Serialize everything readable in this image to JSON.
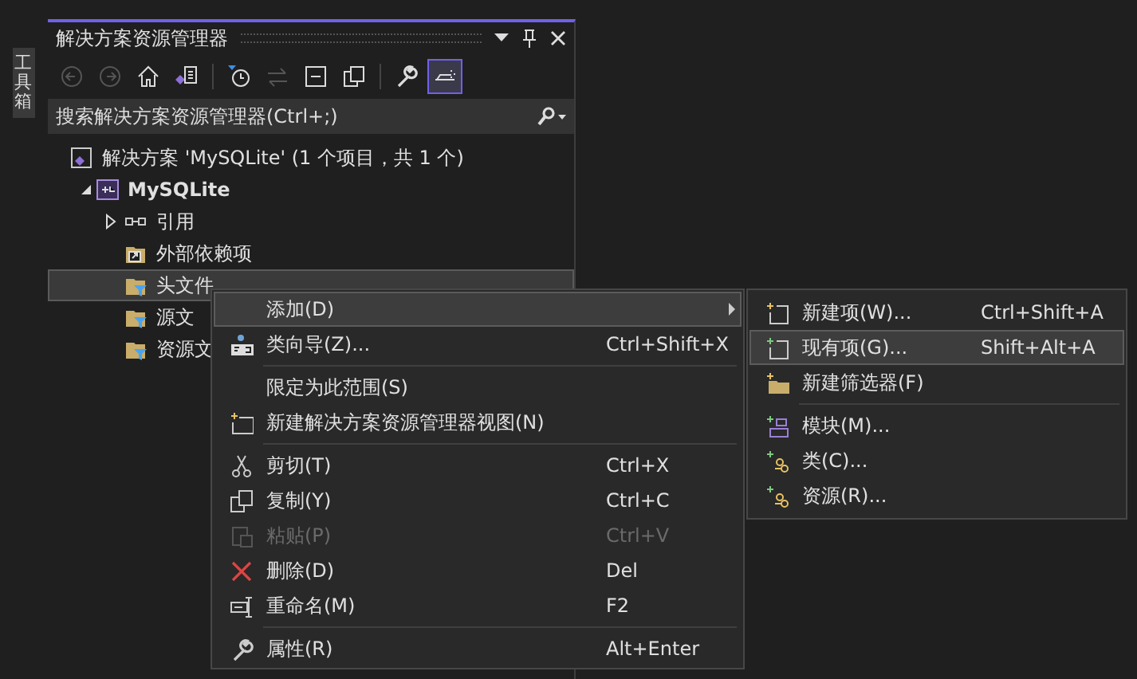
{
  "toolbox": {
    "label": "工具箱"
  },
  "panel": {
    "title": "解决方案资源管理器",
    "toolbar": [
      {
        "kind": "back",
        "disabled": true
      },
      {
        "kind": "forward",
        "disabled": true
      },
      {
        "kind": "home",
        "disabled": false
      },
      {
        "kind": "switch-views",
        "disabled": false
      },
      {
        "kind": "history",
        "disabled": false
      },
      {
        "kind": "sync",
        "disabled": true
      },
      {
        "kind": "collapse",
        "disabled": false
      },
      {
        "kind": "show-all",
        "disabled": false
      },
      {
        "kind": "properties",
        "disabled": false
      },
      {
        "kind": "preview",
        "disabled": false,
        "selected": true
      }
    ],
    "search": {
      "placeholder": "搜索解决方案资源管理器(Ctrl+;)"
    },
    "tree": [
      {
        "kind": "solution",
        "label": "解决方案 'MySQLite' (1 个项目，共 1 个)",
        "selected": false,
        "children": [
          {
            "kind": "project",
            "label": "MySQLite",
            "expanded": true,
            "selected": false,
            "children": [
              {
                "kind": "references",
                "label": "引用",
                "expanded": false,
                "selected": false
              },
              {
                "kind": "external",
                "label": "外部依赖项",
                "selected": false
              },
              {
                "kind": "filter",
                "label": "头文件",
                "selected": true
              },
              {
                "kind": "filter",
                "label": "源文",
                "selected": false
              },
              {
                "kind": "filter",
                "label": "资源文",
                "selected": false
              }
            ]
          }
        ]
      }
    ]
  },
  "context_menu": {
    "items": [
      {
        "kind": "item",
        "label": "添加(D)",
        "submenu": true,
        "selected": true,
        "disabled": false
      },
      {
        "kind": "item",
        "label": "类向导(Z)...",
        "shortcut": "Ctrl+Shift+X",
        "selected": false,
        "disabled": false
      },
      {
        "kind": "separator"
      },
      {
        "kind": "item",
        "label": "限定为此范围(S)",
        "selected": false,
        "disabled": false
      },
      {
        "kind": "item",
        "label": "新建解决方案资源管理器视图(N)",
        "selected": false,
        "disabled": false
      },
      {
        "kind": "separator"
      },
      {
        "kind": "item",
        "label": "剪切(T)",
        "shortcut": "Ctrl+X",
        "selected": false,
        "disabled": false
      },
      {
        "kind": "item",
        "label": "复制(Y)",
        "shortcut": "Ctrl+C",
        "selected": false,
        "disabled": false
      },
      {
        "kind": "item",
        "label": "粘贴(P)",
        "shortcut": "Ctrl+V",
        "selected": false,
        "disabled": true
      },
      {
        "kind": "item",
        "label": "删除(D)",
        "shortcut": "Del",
        "selected": false,
        "disabled": false
      },
      {
        "kind": "item",
        "label": "重命名(M)",
        "shortcut": "F2",
        "selected": false,
        "disabled": false
      },
      {
        "kind": "separator"
      },
      {
        "kind": "item",
        "label": "属性(R)",
        "shortcut": "Alt+Enter",
        "selected": false,
        "disabled": false
      }
    ]
  },
  "submenu": {
    "items": [
      {
        "kind": "item",
        "label": "新建项(W)...",
        "shortcut": "Ctrl+Shift+A",
        "selected": false
      },
      {
        "kind": "item",
        "label": "现有项(G)...",
        "shortcut": "Shift+Alt+A",
        "selected": true
      },
      {
        "kind": "item",
        "label": "新建筛选器(F)",
        "selected": false
      },
      {
        "kind": "separator"
      },
      {
        "kind": "item",
        "label": "模块(M)...",
        "selected": false
      },
      {
        "kind": "item",
        "label": "类(C)...",
        "selected": false
      },
      {
        "kind": "item",
        "label": "资源(R)...",
        "selected": false
      }
    ]
  }
}
